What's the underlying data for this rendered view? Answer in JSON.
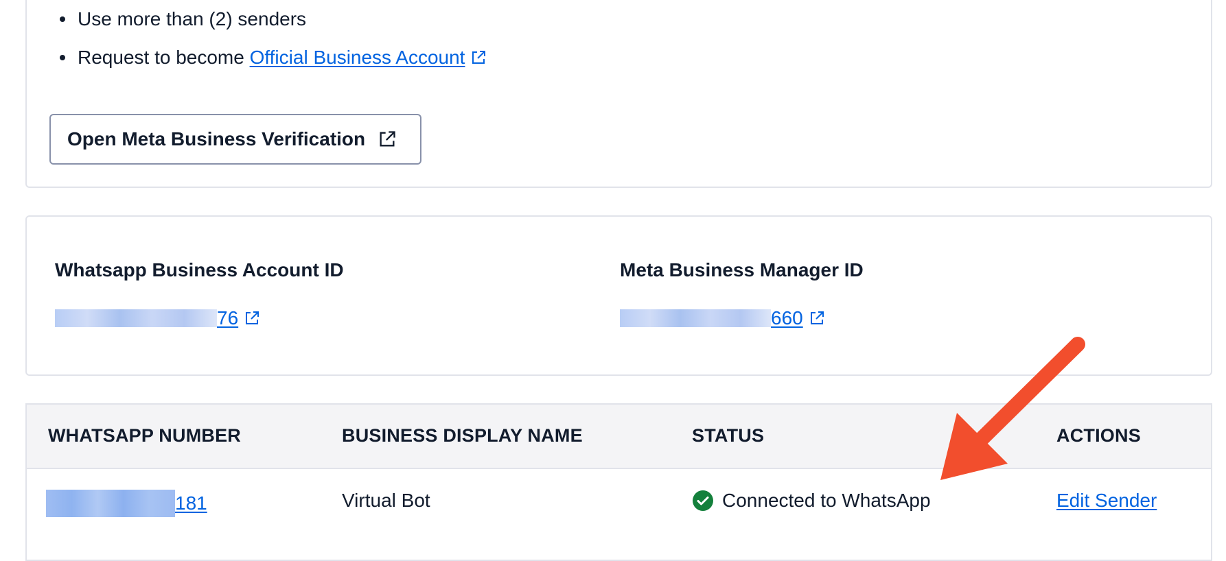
{
  "verification": {
    "bullets": [
      {
        "text": "Use more than (2) senders"
      },
      {
        "text_prefix": "Request to become ",
        "link_text": "Official Business Account"
      }
    ],
    "button_label": "Open Meta Business Verification"
  },
  "ids": {
    "waba_label": "Whatsapp Business Account ID",
    "waba_value_suffix": "76",
    "meta_label": "Meta Business Manager ID",
    "meta_value_suffix": "660"
  },
  "table": {
    "headers": [
      "WHATSAPP NUMBER",
      "BUSINESS DISPLAY NAME",
      "STATUS",
      "ACTIONS"
    ],
    "rows": [
      {
        "number_suffix": "181",
        "display_name": "Virtual Bot",
        "status": "Connected to WhatsApp",
        "action": "Edit Sender"
      }
    ]
  },
  "colors": {
    "link": "#0263e0",
    "success": "#14803c",
    "annotation_arrow": "#f24e2d",
    "header_bg": "#f4f4f6"
  },
  "icons": {
    "external_link": "external-link-icon",
    "status": "check-circle-icon"
  }
}
